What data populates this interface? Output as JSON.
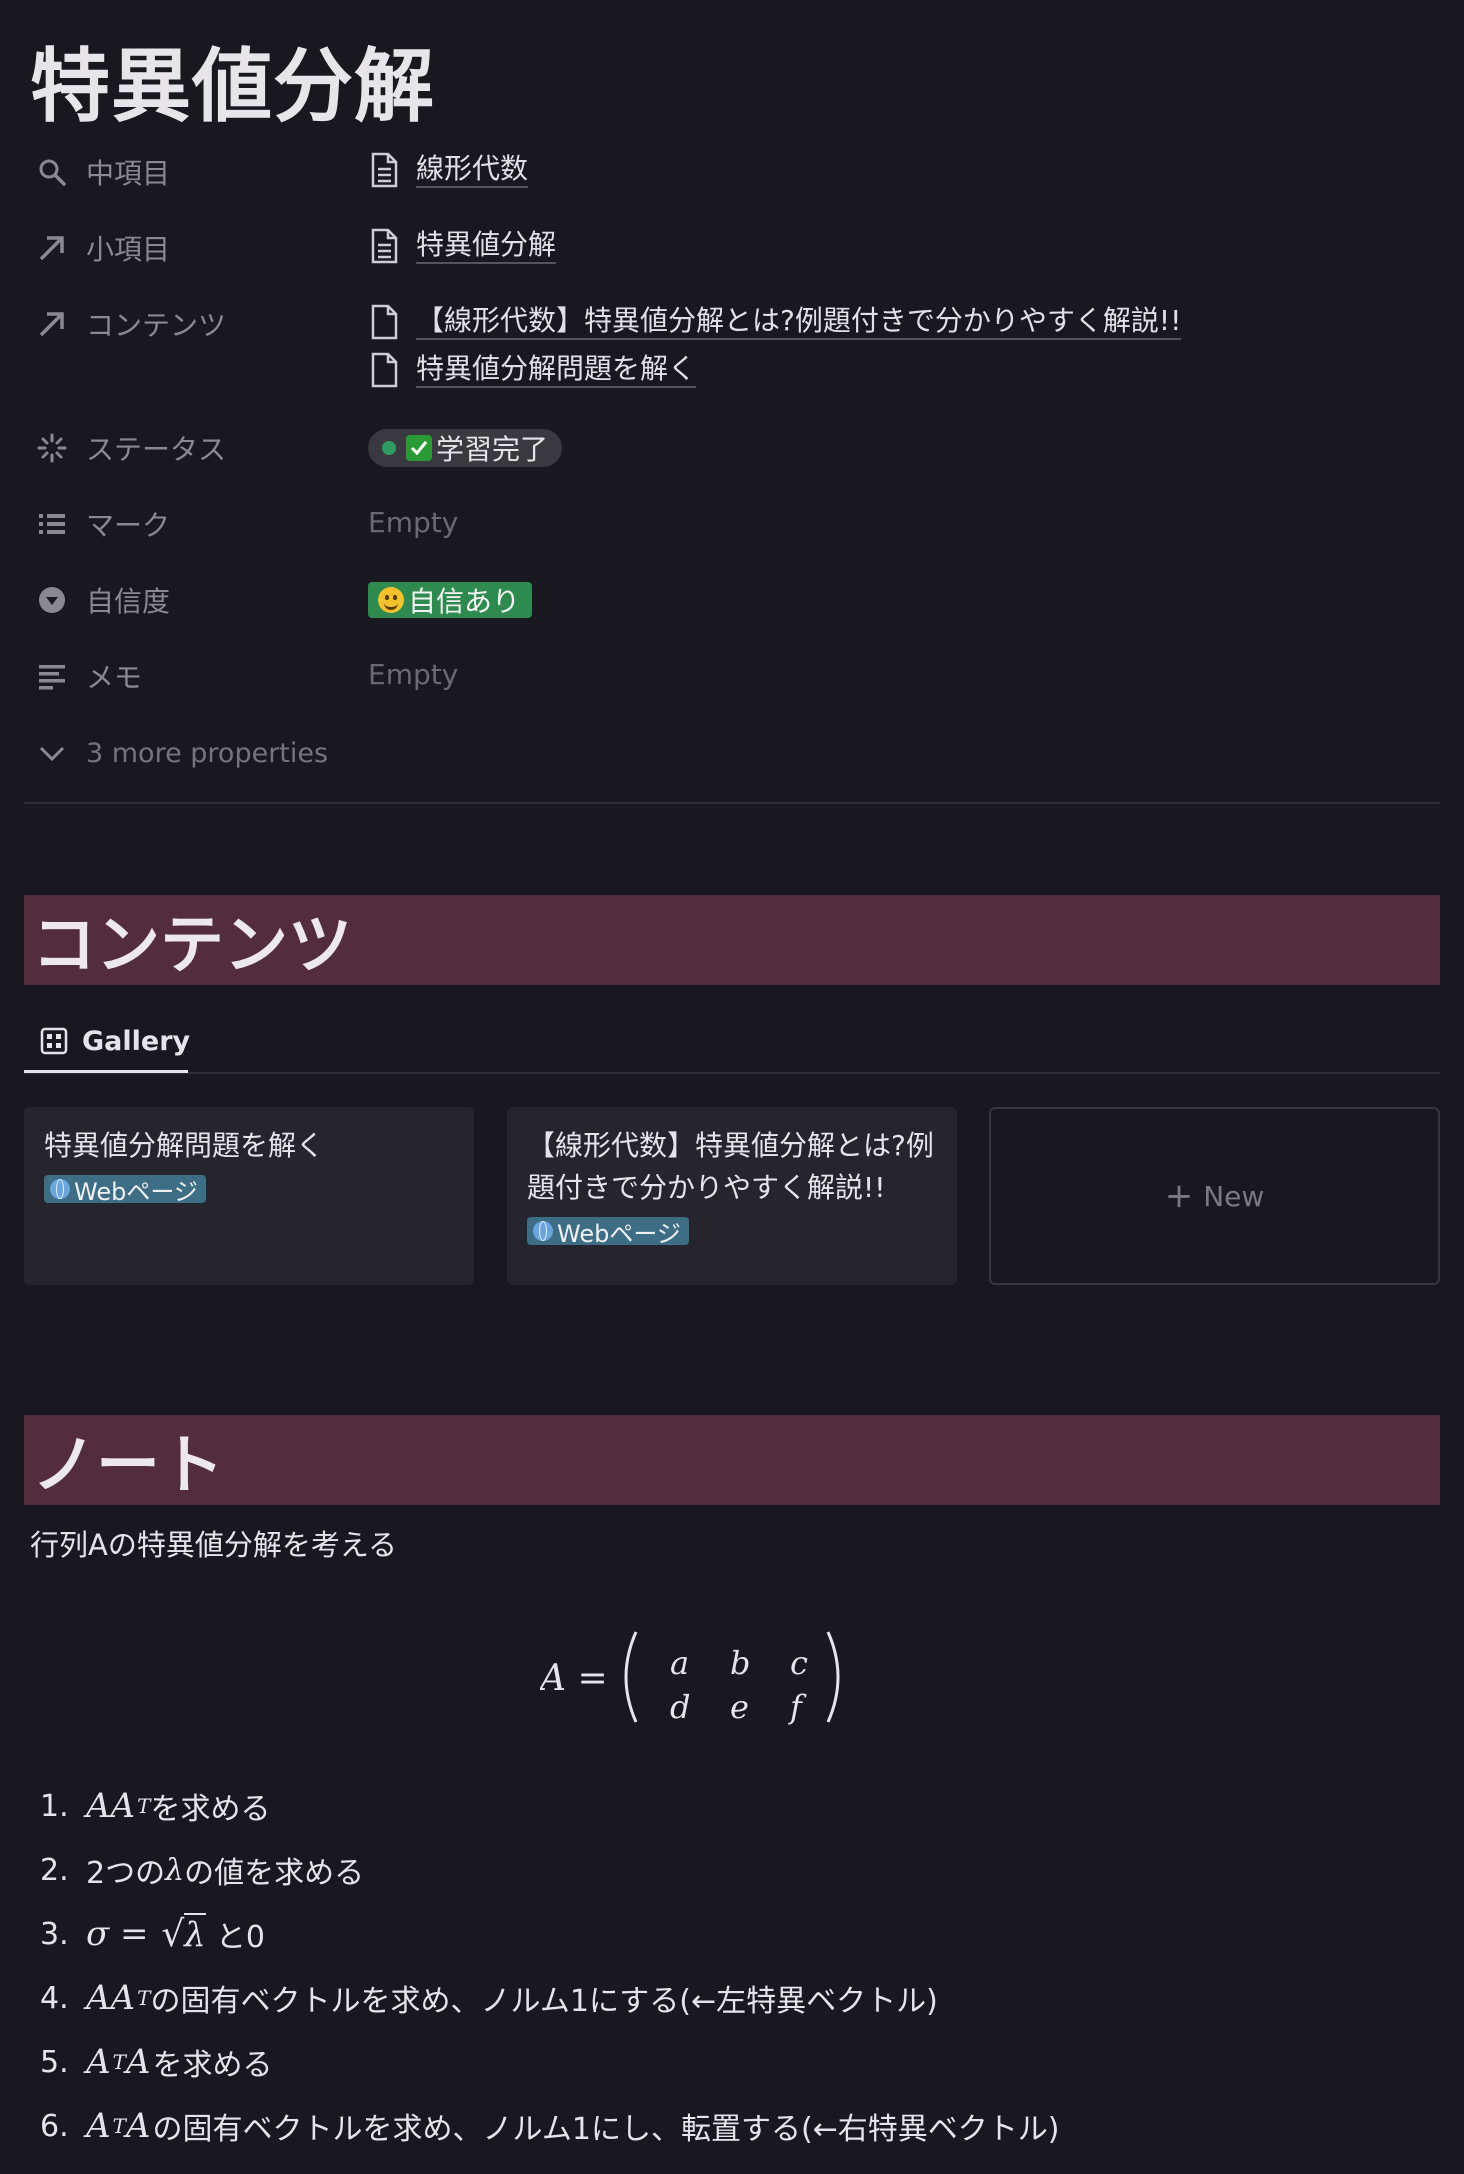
{
  "page_title": "特異値分解",
  "properties": {
    "chukomoku": {
      "label": "中項目",
      "value": "線形代数"
    },
    "shokomoku": {
      "label": "小項目",
      "value": "特異値分解"
    },
    "contents": {
      "label": "コンテンツ",
      "items": [
        "【線形代数】特異値分解とは?例題付きで分かりやすく解説!!",
        "特異値分解問題を解く"
      ]
    },
    "status": {
      "label": "ステータス",
      "value": "学習完了"
    },
    "mark": {
      "label": "マーク",
      "value": "Empty"
    },
    "confidence": {
      "label": "自信度",
      "value": "自信あり"
    },
    "memo": {
      "label": "メモ",
      "value": "Empty"
    },
    "more": "3 more properties"
  },
  "contents_section": {
    "heading": "コンテンツ",
    "tab": "Gallery",
    "cards": [
      {
        "title": "特異値分解問題を解く",
        "tag": "Webページ"
      },
      {
        "title": "【線形代数】特異値分解とは?例題付きで分かりやすく解説!!",
        "tag": "Webページ"
      }
    ],
    "new_label": "New"
  },
  "note_section": {
    "heading": "ノート",
    "intro": "行列Aの特異値分解を考える",
    "equation": {
      "lhs": "A =",
      "row1": [
        "a",
        "b",
        "c"
      ],
      "row2": [
        "d",
        "e",
        "f"
      ]
    },
    "steps": [
      {
        "num": "1.",
        "math": "AA",
        "sup": "T",
        "text": "を求める"
      },
      {
        "num": "2.",
        "prefix": "2つの",
        "lambda": "λ",
        "text": "の値を求める"
      },
      {
        "num": "3.",
        "math": "σ = ",
        "sqrt": "λ",
        "text": "と0"
      },
      {
        "num": "4.",
        "math": "AA",
        "sup": "T",
        "text": "の固有ベクトルを求め、ノルム1にする(←左特異ベクトル)"
      },
      {
        "num": "5.",
        "math": "A",
        "sup": "T",
        "math2": "A",
        "text": "を求める"
      },
      {
        "num": "6.",
        "math": "A",
        "sup": "T",
        "math2": "A",
        "text": "の固有ベクトルを求め、ノルム1にし、転置する(←右特異ベクトル)"
      }
    ]
  },
  "colors": {
    "background": "#191720",
    "heading_band": "#532d3c",
    "status_dot": "#2f9c64",
    "confidence_tag": "#2e8a4f",
    "web_tag": "#3d6e86"
  }
}
